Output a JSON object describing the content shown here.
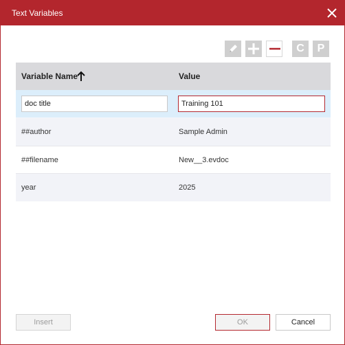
{
  "window": {
    "title": "Text Variables"
  },
  "toolbar": {
    "items": [
      {
        "icon": "pencil-icon"
      },
      {
        "icon": "plus-icon"
      },
      {
        "icon": "minus-icon"
      },
      {
        "icon": "c-icon",
        "label": "C"
      },
      {
        "icon": "p-icon",
        "label": "P"
      }
    ]
  },
  "table": {
    "columns": [
      "Variable Name",
      "Value"
    ],
    "sort_icon": "arrow-up-icon",
    "rows": [
      {
        "name": "doc title",
        "value": "Training 101"
      },
      {
        "name": "##author",
        "value": "Sample Admin"
      },
      {
        "name": "##filename",
        "value": "New__3.evdoc"
      },
      {
        "name": "year",
        "value": "2025"
      }
    ]
  },
  "buttons": {
    "insert": "Insert",
    "ok": "OK",
    "cancel": "Cancel"
  },
  "colors": {
    "accent": "#b3262d",
    "selection": "#dceefb",
    "header": "#d9d9dc"
  }
}
